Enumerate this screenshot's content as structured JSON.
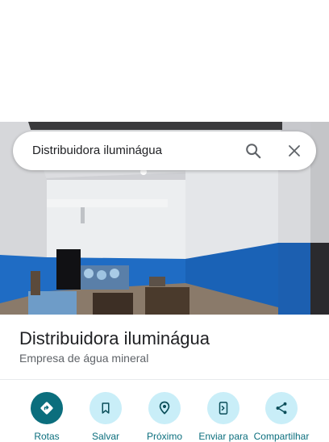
{
  "search": {
    "query": "Distribuidora iluminágua",
    "search_icon": "search-icon",
    "close_icon": "close-icon"
  },
  "place": {
    "name": "Distribuidora iluminágua",
    "category": "Empresa de água mineral"
  },
  "actions": [
    {
      "label": "Rotas",
      "icon": "directions-icon"
    },
    {
      "label": "Salvar",
      "icon": "bookmark-icon"
    },
    {
      "label": "Próximo",
      "icon": "nearby-icon"
    },
    {
      "label": "Enviar para",
      "icon": "send-to-phone-icon"
    },
    {
      "label": "Compartilhar",
      "icon": "share-icon"
    }
  ],
  "colors": {
    "accent": "#0b6e7d",
    "action_bg": "#c9eef8",
    "wall_blue": "#1f6cc4"
  }
}
